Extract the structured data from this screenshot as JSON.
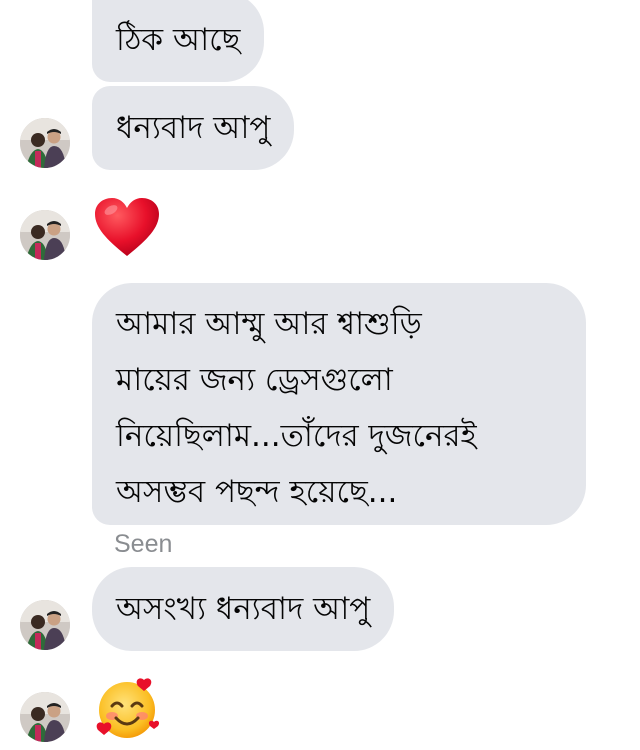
{
  "conversation": {
    "messages": [
      {
        "text": "ঠিক আছে"
      },
      {
        "text": "ধন্যবাদ আপু"
      },
      {
        "reaction": "heart-icon"
      },
      {
        "lines": [
          "আমার আম্মু আর শ্বাশুড়ি",
          "মায়ের জন্য ড্রেসগুলো",
          "নিয়েছিলাম...তাঁদের দুজনেরই",
          "অসম্ভব পছন্দ হয়েছে..."
        ]
      },
      {
        "text": "অসংখ্য ধন্যবাদ আপু"
      },
      {
        "reaction": "smiling-face-with-hearts-icon"
      }
    ],
    "read_receipt": "Seen"
  }
}
